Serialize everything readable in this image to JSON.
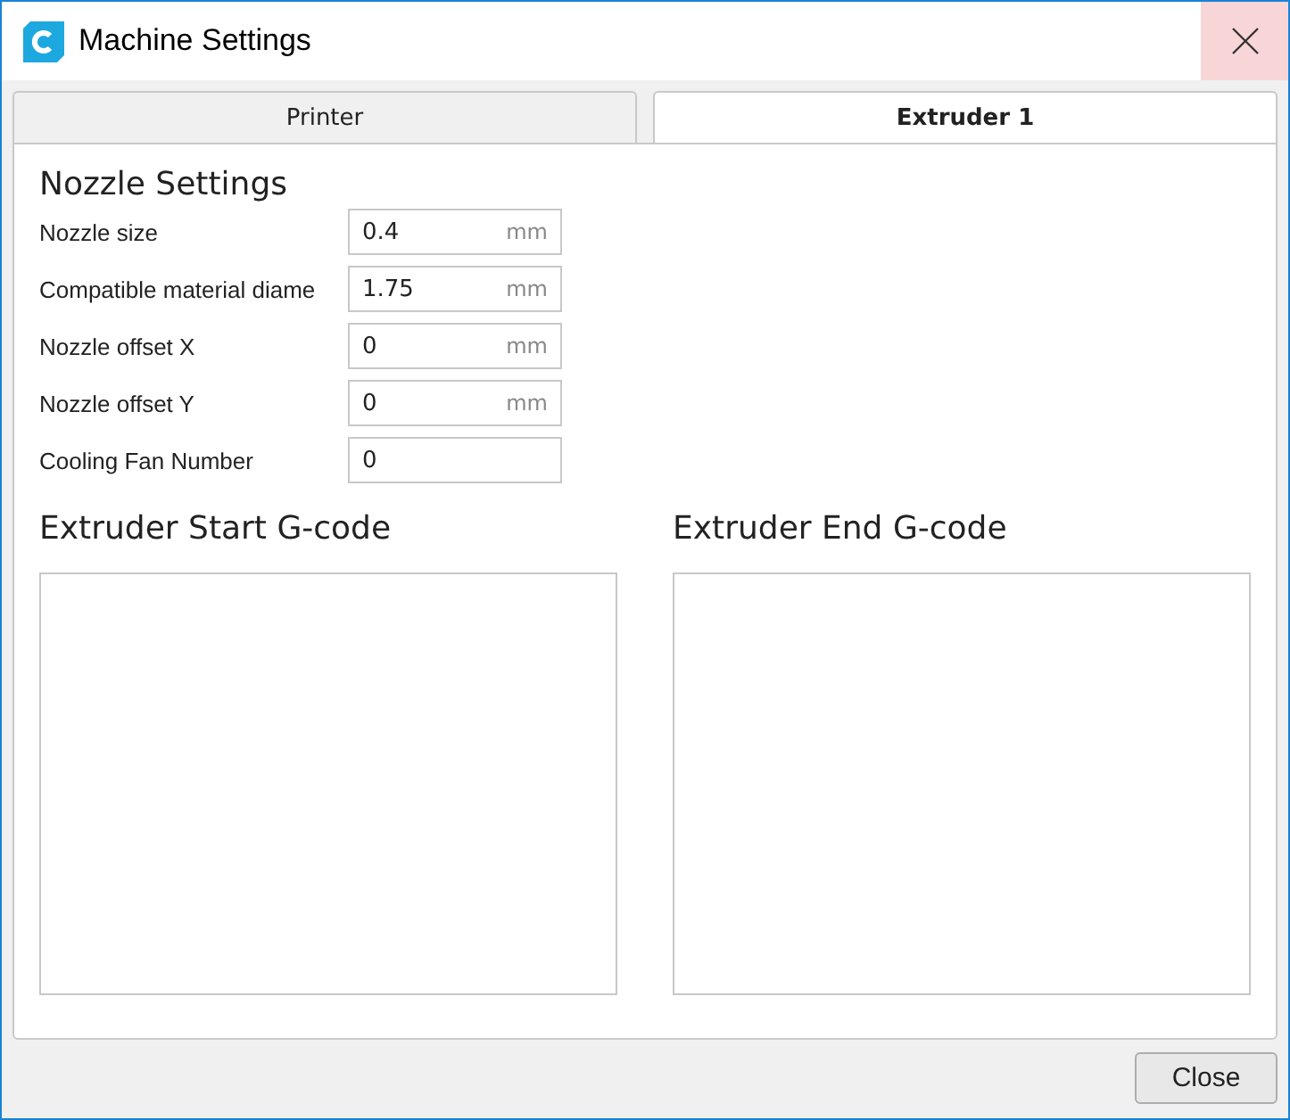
{
  "window": {
    "title": "Machine Settings"
  },
  "tabs": [
    {
      "label": "Printer",
      "selected": false
    },
    {
      "label": "Extruder 1",
      "selected": true
    }
  ],
  "nozzle_settings": {
    "title": "Nozzle Settings",
    "fields": [
      {
        "label": "Nozzle size",
        "value": "0.4",
        "unit": "mm"
      },
      {
        "label": "Compatible material diame",
        "value": "1.75",
        "unit": "mm"
      },
      {
        "label": "Nozzle offset X",
        "value": "0",
        "unit": "mm"
      },
      {
        "label": "Nozzle offset Y",
        "value": "0",
        "unit": "mm"
      },
      {
        "label": "Cooling Fan Number",
        "value": "0"
      }
    ]
  },
  "gcode": [
    {
      "title": "Extruder Start G-code"
    },
    {
      "title": "Extruder End G-code"
    }
  ],
  "buttons": [
    "Close"
  ]
}
